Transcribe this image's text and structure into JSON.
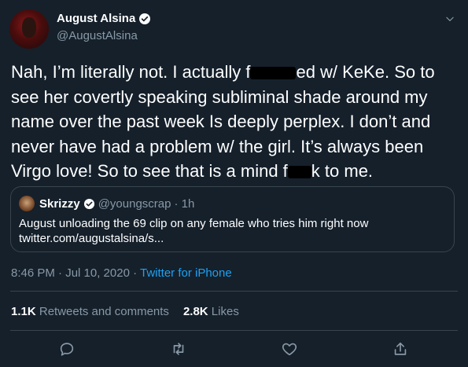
{
  "author": {
    "name": "August Alsina",
    "handle": "@AugustAlsina"
  },
  "tweet": {
    "text_parts": [
      "Nah, I’m literally not. I actually f",
      "ed w/ KeKe. So to see her covertly speaking subliminal shade around my name over the past week Is deeply perplex.  I don’t and never have had a problem w/ the girl. It’s always been Virgo love! So to see that is a mind f",
      "k to me."
    ]
  },
  "quote": {
    "name": "Skrizzy",
    "handle": "@youngscrap",
    "time": "· 1h",
    "text": "August unloading the 69 clip on any female who tries him right now",
    "link": "twitter.com/augustalsina/s..."
  },
  "meta": {
    "time": "8:46 PM · Jul 10, 2020 · ",
    "source": "Twitter for iPhone"
  },
  "stats": {
    "retweets_count": "1.1K",
    "retweets_label": "Retweets and comments",
    "likes_count": "2.8K",
    "likes_label": "Likes"
  },
  "colors": {
    "background": "#15202b",
    "muted": "#8899a6",
    "accent": "#1da1f2",
    "border": "#38444d"
  },
  "icons": [
    "verified-badge-icon",
    "chevron-down-icon",
    "reply-icon",
    "retweet-icon",
    "like-icon",
    "share-icon"
  ]
}
